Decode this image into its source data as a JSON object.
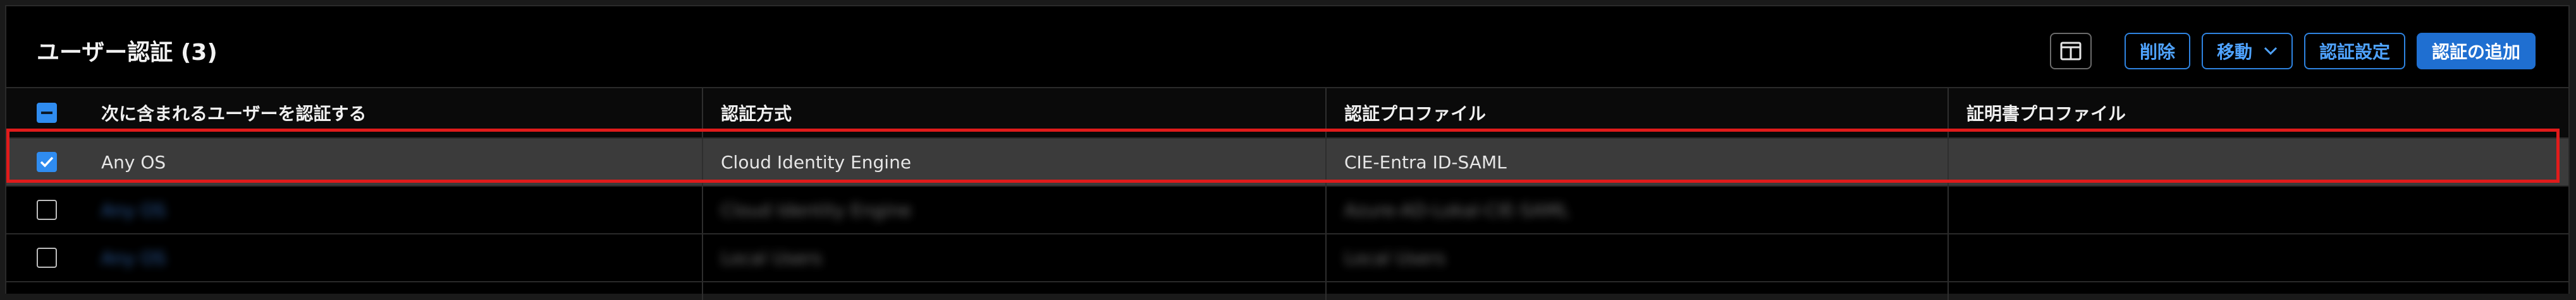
{
  "panel": {
    "title": "ユーザー認証 (3)"
  },
  "toolbar": {
    "columns_icon": "columns-icon",
    "delete_label": "削除",
    "move_label": "移動",
    "auth_settings_label": "認証設定",
    "add_auth_label": "認証の追加"
  },
  "table": {
    "columns": [
      "次に含まれるユーザーを認証する",
      "認証方式",
      "認証プロファイル",
      "証明書プロファイル"
    ],
    "rows": [
      {
        "checked": true,
        "users": "Any OS",
        "method": "Cloud Identity Engine",
        "profile": "CIE-Entra ID-SAML",
        "cert": ""
      },
      {
        "checked": false,
        "users": "Any OS",
        "method": "Cloud Identity Engine",
        "profile": "Azure-AD-Lokal-CIE-SAML",
        "cert": ""
      },
      {
        "checked": false,
        "users": "Any OS",
        "method": "Local Users",
        "profile": "Local Users",
        "cert": ""
      }
    ]
  },
  "colors": {
    "accent": "#2f8cf0",
    "selection_outline": "#e01b1b",
    "selected_row": "#3b3b3b"
  }
}
